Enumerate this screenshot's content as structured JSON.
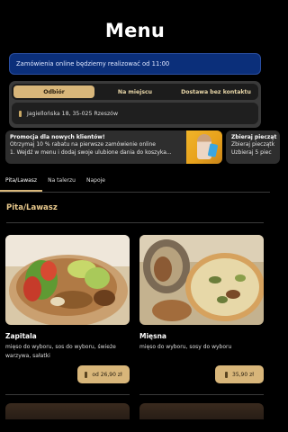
{
  "header": {
    "title": "Menu"
  },
  "banner": {
    "text": "Zamówienia online będziemy realizować od 11:00"
  },
  "order_options": {
    "tabs": [
      {
        "label": "Odbiór",
        "active": true
      },
      {
        "label": "Na miejscu",
        "active": false
      },
      {
        "label": "Dostawa bez kontaktu",
        "active": false
      }
    ],
    "address": "Jagiellońska 18, 35-025 Rzeszów"
  },
  "promos": [
    {
      "title": "Promocja dla nowych klientów!",
      "line1": "Otrzymaj 10 % rabatu na pierwsze zamówienie online",
      "line2": "1. Wejdź w menu i dodaj swoje ulubione dania do koszyka..."
    },
    {
      "title": "Zbieraj piecząt",
      "line1": "Zbieraj pieczątk",
      "line2": "Uzbieraj 5 piec"
    }
  ],
  "category_tabs": [
    {
      "label": "Pita/Lawasz",
      "active": true
    },
    {
      "label": "Na talerzu",
      "active": false
    },
    {
      "label": "Napoje",
      "active": false
    }
  ],
  "section": {
    "title": "Pita/Lawasz"
  },
  "products": [
    {
      "name": "Zapitala",
      "description": "mięso do wyboru, sos do wyboru, świeże warzywa, sałatki",
      "price": "od 26,90 zł"
    },
    {
      "name": "Mięsna",
      "description": "mięso do wyboru, sosy do wyboru",
      "price": "35,90 zł"
    }
  ],
  "colors": {
    "background": "#000000",
    "accent": "#d8b67a",
    "banner": "#0b2f7a",
    "section_title": "#e9c98c"
  }
}
